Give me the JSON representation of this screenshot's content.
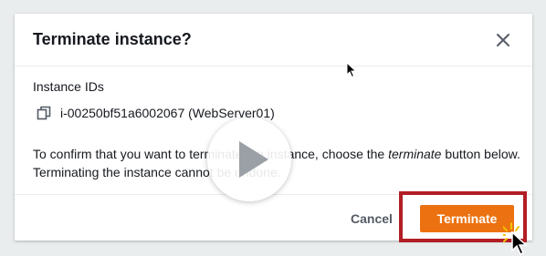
{
  "modal": {
    "title": "Terminate instance?",
    "close_icon": "close-icon",
    "field_label": "Instance IDs",
    "instance": {
      "icon": "copy-icon",
      "text": "i-00250bf51a6002067 (WebServer01)"
    },
    "confirm": {
      "part1": "To confirm that you want to terminate the instance, choose the ",
      "emphasis": "terminate",
      "part2": " button below. Terminating the instance cannot be undone."
    },
    "footer": {
      "cancel_label": "Cancel",
      "terminate_label": "Terminate"
    }
  },
  "overlay": {
    "play_icon": "play-icon",
    "pointer_icon": "mouse-pointer-icon"
  },
  "colors": {
    "primary_button": "#ec7211",
    "highlight_border": "#b11e24",
    "text": "#16191f",
    "muted_text": "#545b64",
    "background": "#eaeded"
  }
}
